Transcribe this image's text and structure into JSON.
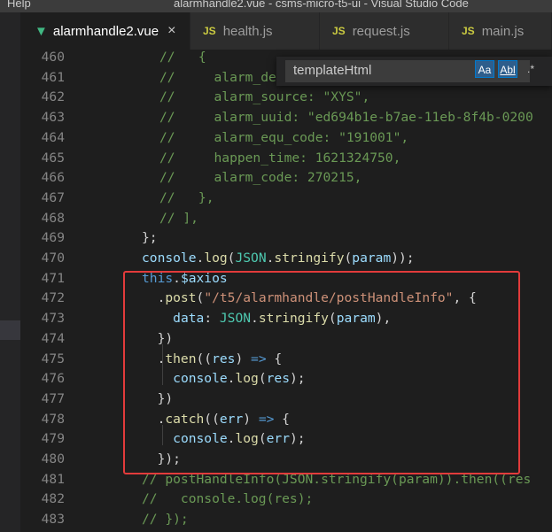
{
  "titlebar": {
    "menu_label": "Help",
    "window_title": "alarmhandle2.vue - csms-micro-t5-ui - Visual Studio Code"
  },
  "tabs": [
    {
      "label": "alarmhandle2.vue",
      "icon": "vue-icon",
      "active": true,
      "close_glyph": "×"
    },
    {
      "label": "health.js",
      "icon_text": "JS",
      "active": false
    },
    {
      "label": "request.js",
      "icon_text": "JS",
      "active": false
    },
    {
      "label": "main.js",
      "icon_text": "JS",
      "active": false
    }
  ],
  "find_widget": {
    "query": "templateHtml",
    "options": [
      "Aa",
      "Abl",
      ".*"
    ]
  },
  "code_lines": [
    {
      "number": "460",
      "segments": [
        [
          "c-comment",
          "//   {"
        ]
      ]
    },
    {
      "number": "461",
      "segments": [
        [
          "c-comment",
          "//     alarm_de"
        ]
      ]
    },
    {
      "number": "462",
      "segments": [
        [
          "c-comment",
          "//     alarm_source: \"XYS\","
        ]
      ]
    },
    {
      "number": "463",
      "segments": [
        [
          "c-comment",
          "//     alarm_uuid: \"ed694b1e-b7ae-11eb-8f4b-0200"
        ]
      ]
    },
    {
      "number": "464",
      "segments": [
        [
          "c-comment",
          "//     alarm_equ_code: \"191001\","
        ]
      ]
    },
    {
      "number": "465",
      "segments": [
        [
          "c-comment",
          "//     happen_time: 1621324750,"
        ]
      ]
    },
    {
      "number": "466",
      "segments": [
        [
          "c-comment",
          "//     alarm_code: 270215,"
        ]
      ]
    },
    {
      "number": "467",
      "segments": [
        [
          "c-comment",
          "//   },"
        ]
      ]
    },
    {
      "number": "468",
      "segments": [
        [
          "c-comment",
          "// ],"
        ]
      ]
    },
    {
      "number": "469",
      "segments": [
        [
          "c-punc",
          "};"
        ]
      ]
    },
    {
      "number": "470",
      "segments": [
        [
          "c-var",
          "console"
        ],
        [
          "c-punc",
          "."
        ],
        [
          "c-fn",
          "log"
        ],
        [
          "c-punc",
          "("
        ],
        [
          "c-cls",
          "JSON"
        ],
        [
          "c-punc",
          "."
        ],
        [
          "c-fn",
          "stringify"
        ],
        [
          "c-punc",
          "("
        ],
        [
          "c-var",
          "param"
        ],
        [
          "c-punc",
          "));"
        ]
      ]
    },
    {
      "number": "471",
      "segments": [
        [
          "c-key",
          "this"
        ],
        [
          "c-punc",
          "."
        ],
        [
          "c-var",
          "$axios"
        ]
      ]
    },
    {
      "number": "472",
      "segments": [
        [
          "c-punc",
          "  ."
        ],
        [
          "c-fn",
          "post"
        ],
        [
          "c-punc",
          "("
        ],
        [
          "c-str",
          "\"/t5/alarmhandle/postHandleInfo\""
        ],
        [
          "c-punc",
          ", {"
        ]
      ]
    },
    {
      "number": "473",
      "segments": [
        [
          "c-punc",
          "    "
        ],
        [
          "c-var",
          "data"
        ],
        [
          "c-punc",
          ": "
        ],
        [
          "c-cls",
          "JSON"
        ],
        [
          "c-punc",
          "."
        ],
        [
          "c-fn",
          "stringify"
        ],
        [
          "c-punc",
          "("
        ],
        [
          "c-var",
          "param"
        ],
        [
          "c-punc",
          "),"
        ]
      ]
    },
    {
      "number": "474",
      "segments": [
        [
          "c-punc",
          "  })"
        ]
      ]
    },
    {
      "number": "475",
      "segments": [
        [
          "c-punc",
          "  ."
        ],
        [
          "c-fn",
          "then"
        ],
        [
          "c-punc",
          "(("
        ],
        [
          "c-var",
          "res"
        ],
        [
          "c-punc",
          ") "
        ],
        [
          "c-key",
          "=>"
        ],
        [
          "c-punc",
          " {"
        ]
      ]
    },
    {
      "number": "476",
      "segments": [
        [
          "c-punc",
          "    "
        ],
        [
          "c-var",
          "console"
        ],
        [
          "c-punc",
          "."
        ],
        [
          "c-fn",
          "log"
        ],
        [
          "c-punc",
          "("
        ],
        [
          "c-var",
          "res"
        ],
        [
          "c-punc",
          ");"
        ]
      ]
    },
    {
      "number": "477",
      "segments": [
        [
          "c-punc",
          "  })"
        ]
      ]
    },
    {
      "number": "478",
      "segments": [
        [
          "c-punc",
          "  ."
        ],
        [
          "c-fn",
          "catch"
        ],
        [
          "c-punc",
          "(("
        ],
        [
          "c-var",
          "err"
        ],
        [
          "c-punc",
          ") "
        ],
        [
          "c-key",
          "=>"
        ],
        [
          "c-punc",
          " {"
        ]
      ]
    },
    {
      "number": "479",
      "segments": [
        [
          "c-punc",
          "    "
        ],
        [
          "c-var",
          "console"
        ],
        [
          "c-punc",
          "."
        ],
        [
          "c-fn",
          "log"
        ],
        [
          "c-punc",
          "("
        ],
        [
          "c-var",
          "err"
        ],
        [
          "c-punc",
          ");"
        ]
      ]
    },
    {
      "number": "480",
      "segments": [
        [
          "c-punc",
          "  });"
        ]
      ]
    },
    {
      "number": "481",
      "segments": [
        [
          "c-comment",
          "// postHandleInfo(JSON.stringify(param)).then((res"
        ]
      ]
    },
    {
      "number": "482",
      "segments": [
        [
          "c-comment",
          "//   console.log(res);"
        ]
      ]
    },
    {
      "number": "483",
      "segments": [
        [
          "c-comment",
          "// });"
        ]
      ]
    }
  ],
  "colors": {
    "highlight_box": "#e23b3b",
    "editor_bg": "#1e1e1e",
    "find_option_active": "#007acc"
  }
}
